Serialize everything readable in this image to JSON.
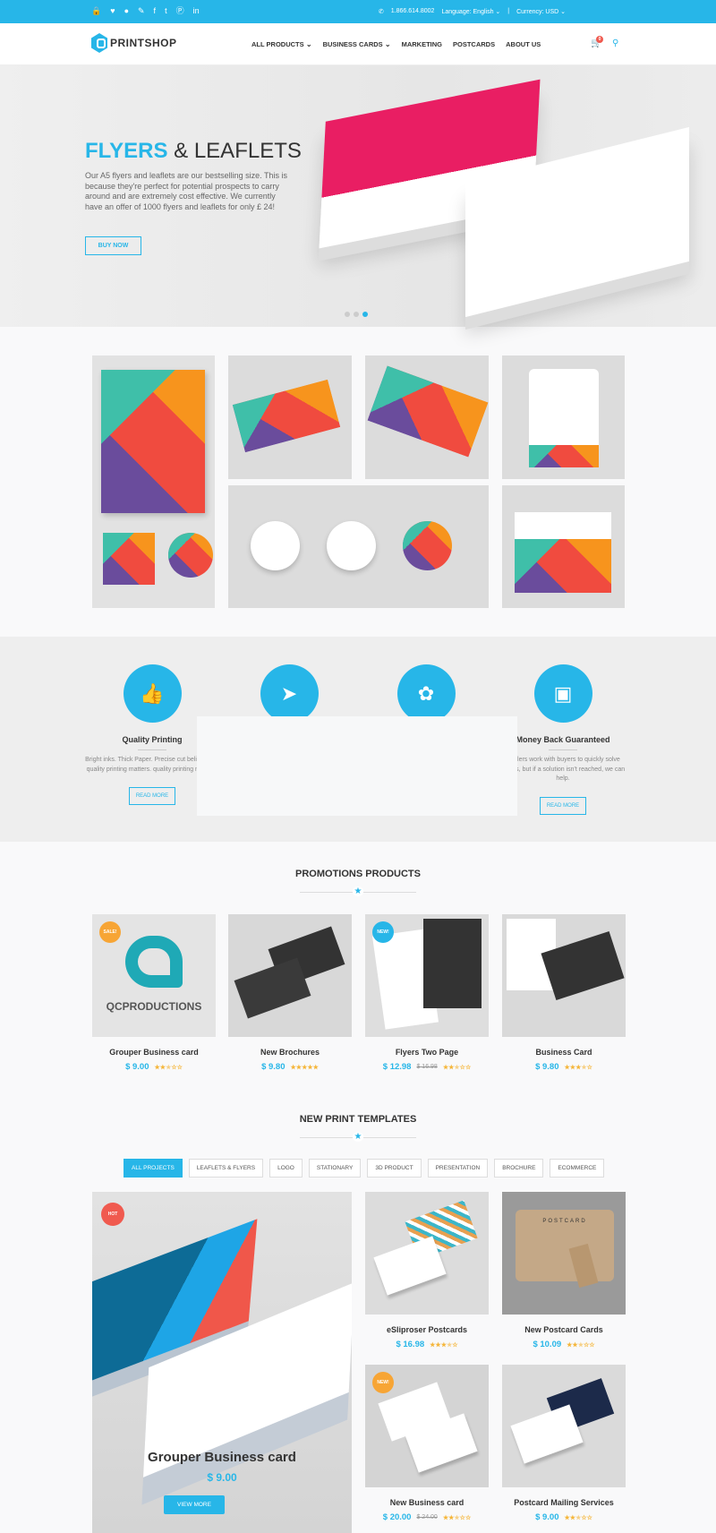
{
  "colors": {
    "accent": "#27b6e8",
    "hot": "#f05a4f",
    "sale": "#f7a535",
    "star": "#f5b63a"
  },
  "topbar": {
    "icons": [
      "lock-icon",
      "heart-icon",
      "user-icon",
      "pencil-icon",
      "facebook-icon",
      "twitter-icon",
      "pinterest-icon",
      "linkedin-icon"
    ],
    "phone": "1.866.614.8002",
    "language": "Language: English",
    "currency": "Currency: USD"
  },
  "header": {
    "logo": "PRINTSHOP",
    "nav": [
      {
        "label": "ALL PRODUCTS",
        "dropdown": true
      },
      {
        "label": "BUSINESS CARDS",
        "dropdown": true
      },
      {
        "label": "MARKETING"
      },
      {
        "label": "POSTCARDS"
      },
      {
        "label": "ABOUT US"
      }
    ],
    "cart_count": "0"
  },
  "hero": {
    "title_accent": "FLYERS",
    "title_rest": " & LEAFLETS",
    "text": "Our A5 flyers and leaflets are our bestselling size. This is because they're perfect for potential prospects to carry around and are extremely cost effective. We currently have an offer of 1000 flyers and leaflets for only £ 24!",
    "button": "BUY NOW",
    "slides": 3,
    "active_slide": 3
  },
  "features": [
    {
      "icon": "thumbs-up-icon",
      "title": "Quality Printing",
      "text": "Bright inks. Thick Paper. Precise cut believe that quality printing matters. quality printing matters.",
      "button": "READ MORE"
    },
    {
      "icon": "paper-plane-icon"
    },
    {
      "icon": "leaf-icon"
    },
    {
      "icon": "money-icon",
      "title": "Money Back Guaranteed",
      "text": "t sellers work with buyers to quickly solve issues, but if a solution isn't reached, we can help.",
      "button": "READ MORE"
    }
  ],
  "promotions": {
    "title": "PROMOTIONS PRODUCTS",
    "items": [
      {
        "name": "Grouper Business card",
        "price": "$ 9.00",
        "rating": 2.5,
        "badge": "SALE!",
        "logo_text": "QCPRODUCTIONS"
      },
      {
        "name": "New Brochures",
        "price": "$ 9.80",
        "rating": 5
      },
      {
        "name": "Flyers Two Page",
        "price": "$ 12.98",
        "old_price": "$ 16.98",
        "rating": 2.5,
        "badge": "NEW!"
      },
      {
        "name": "Business Card",
        "price": "$ 9.80",
        "rating": 3.5
      }
    ]
  },
  "templates": {
    "title": "NEW PRINT TEMPLATES",
    "filters": [
      "ALL PROJECTS",
      "LEAFLETS & FLYERS",
      "LOGO",
      "STATIONARY",
      "3D PRODUCT",
      "PRESENTATION",
      "BROCHURE",
      "ECOMMERCE"
    ],
    "active_filter": "ALL PROJECTS",
    "featured": {
      "name": "Grouper Business card",
      "price": "$ 9.00",
      "badge": "HOT",
      "button": "VIEW MORE"
    },
    "items": [
      {
        "name": "eSliproser Postcards",
        "price": "$ 16.98",
        "rating": 3.5
      },
      {
        "name": "New Postcard Cards",
        "price": "$ 10.09",
        "rating": 2.5,
        "label": "POSTCARD"
      },
      {
        "name": "New Business card",
        "price": "$ 20.00",
        "old_price": "$ 24.00",
        "rating": 2.5,
        "badge": "NEW!"
      },
      {
        "name": "Postcard Mailing Services",
        "price": "$ 9.00",
        "rating": 2.5
      }
    ]
  }
}
